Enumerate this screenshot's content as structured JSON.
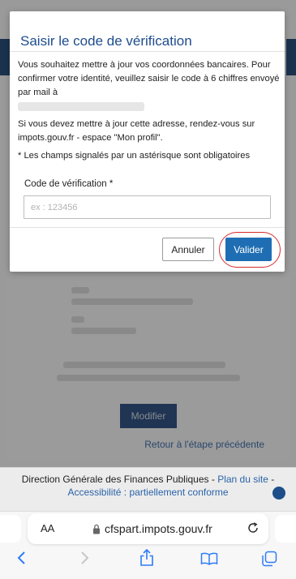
{
  "background": {
    "modify_label": "Modifier",
    "back_link": "Retour à l'étape précédente"
  },
  "footer": {
    "text": "Direction Générale des Finances Publiques - ",
    "site_map": "Plan du site",
    "dash": " -",
    "accessibility": "Accessibilité : partiellement conforme"
  },
  "modal": {
    "title": "Saisir le code de vérification",
    "paragraph1": "Vous souhaitez mettre à jour vos coordonnées bancaires. Pour confirmer votre identité, veuillez saisir le code à 6 chiffres envoyé par mail à",
    "paragraph2": "Si vous devez mettre à jour cette adresse, rendez-vous sur impots.gouv.fr - espace \"Mon profil\".",
    "required_note": "* Les champs signalés par un astérisque sont obligatoires",
    "code_label": "Code de vérification *",
    "code_placeholder": "ex : 123456",
    "code_value": "",
    "cancel_label": "Annuler",
    "validate_label": "Valider"
  },
  "browser": {
    "text_size_label": "AA",
    "url": "cfspart.impots.gouv.fr",
    "icons": [
      "lock-icon",
      "reload-icon",
      "back-icon",
      "forward-icon",
      "share-icon",
      "bookmarks-icon",
      "tabs-icon"
    ]
  },
  "colors": {
    "title_blue": "#1e4c8e",
    "validate_button": "#1f6eb4",
    "highlight_circle": "#d62c2c",
    "safari_blue": "#2f7cf6"
  }
}
